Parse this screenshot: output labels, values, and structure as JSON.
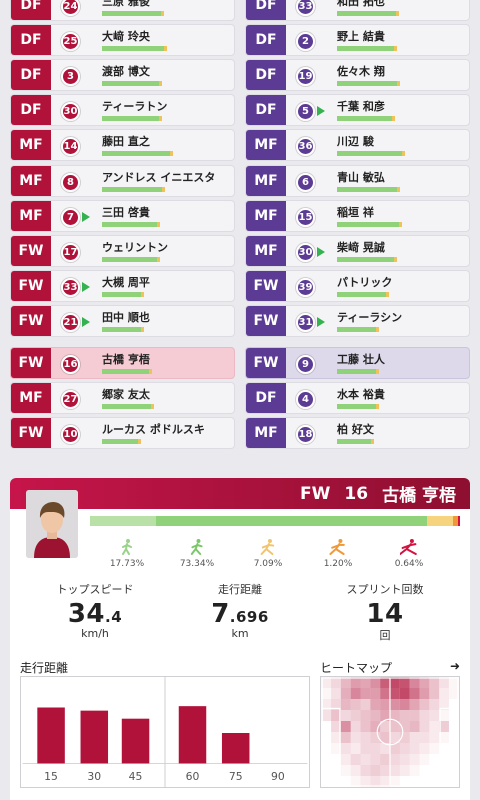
{
  "colors": {
    "home": "#b0123a",
    "away": "#5c3b94",
    "bar": "#8fd27a",
    "accent": "#c6154a"
  },
  "home": [
    {
      "pos": "DF",
      "num": "24",
      "name": "三原 雅俊",
      "bar": 0.45
    },
    {
      "pos": "DF",
      "num": "25",
      "name": "大﨑 玲央",
      "bar": 0.48
    },
    {
      "pos": "DF",
      "num": "3",
      "name": "渡部 博文",
      "bar": 0.44
    },
    {
      "pos": "DF",
      "num": "30",
      "name": "ティーラトン",
      "bar": 0.44
    },
    {
      "pos": "MF",
      "num": "14",
      "name": "藤田 直之",
      "bar": 0.52
    },
    {
      "pos": "MF",
      "num": "8",
      "name": "アンドレス イニエスタ",
      "bar": 0.46
    },
    {
      "pos": "MF",
      "num": "7",
      "name": "三田 啓貴",
      "bar": 0.42,
      "sub": true
    },
    {
      "pos": "FW",
      "num": "17",
      "name": "ウェリントン",
      "bar": 0.42
    },
    {
      "pos": "FW",
      "num": "33",
      "name": "大槻 周平",
      "bar": 0.3,
      "sub": true
    },
    {
      "pos": "FW",
      "num": "21",
      "name": "田中 順也",
      "bar": 0.3,
      "sub": true
    },
    {
      "pos": "FW",
      "num": "16",
      "name": "古橋 亨梧",
      "bar": 0.36,
      "highlight": true
    },
    {
      "pos": "MF",
      "num": "27",
      "name": "郷家 友太",
      "bar": 0.38
    },
    {
      "pos": "FW",
      "num": "10",
      "name": "ルーカス ポドルスキ",
      "bar": 0.28
    }
  ],
  "away": [
    {
      "pos": "DF",
      "num": "33",
      "name": "和田 拓也",
      "bar": 0.45
    },
    {
      "pos": "DF",
      "num": "2",
      "name": "野上 結貴",
      "bar": 0.44
    },
    {
      "pos": "DF",
      "num": "19",
      "name": "佐々木 翔",
      "bar": 0.46
    },
    {
      "pos": "DF",
      "num": "5",
      "name": "千葉 和彦",
      "bar": 0.42,
      "sub": true
    },
    {
      "pos": "MF",
      "num": "36",
      "name": "川辺 駿",
      "bar": 0.5
    },
    {
      "pos": "MF",
      "num": "6",
      "name": "青山 敏弘",
      "bar": 0.46
    },
    {
      "pos": "MF",
      "num": "15",
      "name": "稲垣 祥",
      "bar": 0.48
    },
    {
      "pos": "MF",
      "num": "30",
      "name": "柴﨑 晃誠",
      "bar": 0.44,
      "sub": true
    },
    {
      "pos": "FW",
      "num": "39",
      "name": "パトリック",
      "bar": 0.38
    },
    {
      "pos": "FW",
      "num": "31",
      "name": "ティーラシン",
      "bar": 0.3,
      "sub": true
    },
    {
      "pos": "FW",
      "num": "9",
      "name": "工藤 壮人",
      "bar": 0.3,
      "highlight": true
    },
    {
      "pos": "DF",
      "num": "4",
      "name": "水本 裕貴",
      "bar": 0.3
    },
    {
      "pos": "MF",
      "num": "18",
      "name": "柏 好文",
      "bar": 0.26
    }
  ],
  "player": {
    "position": "FW",
    "number": "16",
    "name": "古橋 亨梧",
    "distribution": [
      {
        "label": "17.73%",
        "value": 17.73,
        "color": "#b9e0a7",
        "icon": "walk-icon",
        "icon_color": "#9ad28a"
      },
      {
        "label": "73.34%",
        "value": 73.34,
        "color": "#8fd27a",
        "icon": "jog-icon",
        "icon_color": "#7cc76a"
      },
      {
        "label": "7.09%",
        "value": 7.09,
        "color": "#f6d37e",
        "icon": "run-icon",
        "icon_color": "#f3c46a"
      },
      {
        "label": "1.20%",
        "value": 1.2,
        "color": "#f0993a",
        "icon": "highspeed-run-icon",
        "icon_color": "#f0993a"
      },
      {
        "label": "0.64%",
        "value": 0.64,
        "color": "#d3123f",
        "icon": "sprint-icon",
        "icon_color": "#d3123f"
      }
    ],
    "stats": [
      {
        "label": "トップスピード",
        "main": "34",
        "decimal": ".4",
        "unit": "km/h"
      },
      {
        "label": "走行距離",
        "main": "7",
        "decimal": ".696",
        "unit": "km"
      },
      {
        "label": "スプリント回数",
        "main": "14",
        "decimal": "",
        "unit": "回"
      }
    ]
  },
  "distance_section": {
    "title": "走行距離"
  },
  "heatmap_section": {
    "title": "ヒートマップ",
    "arrow": "➜"
  },
  "chart_data": {
    "type": "bar",
    "categories": [
      "15",
      "30",
      "45",
      "60",
      "75",
      "90"
    ],
    "values": [
      1.25,
      1.18,
      1.0,
      1.28,
      0.68,
      0
    ],
    "ylim": [
      0,
      1.8
    ],
    "xlabel": "",
    "ylabel": ""
  }
}
